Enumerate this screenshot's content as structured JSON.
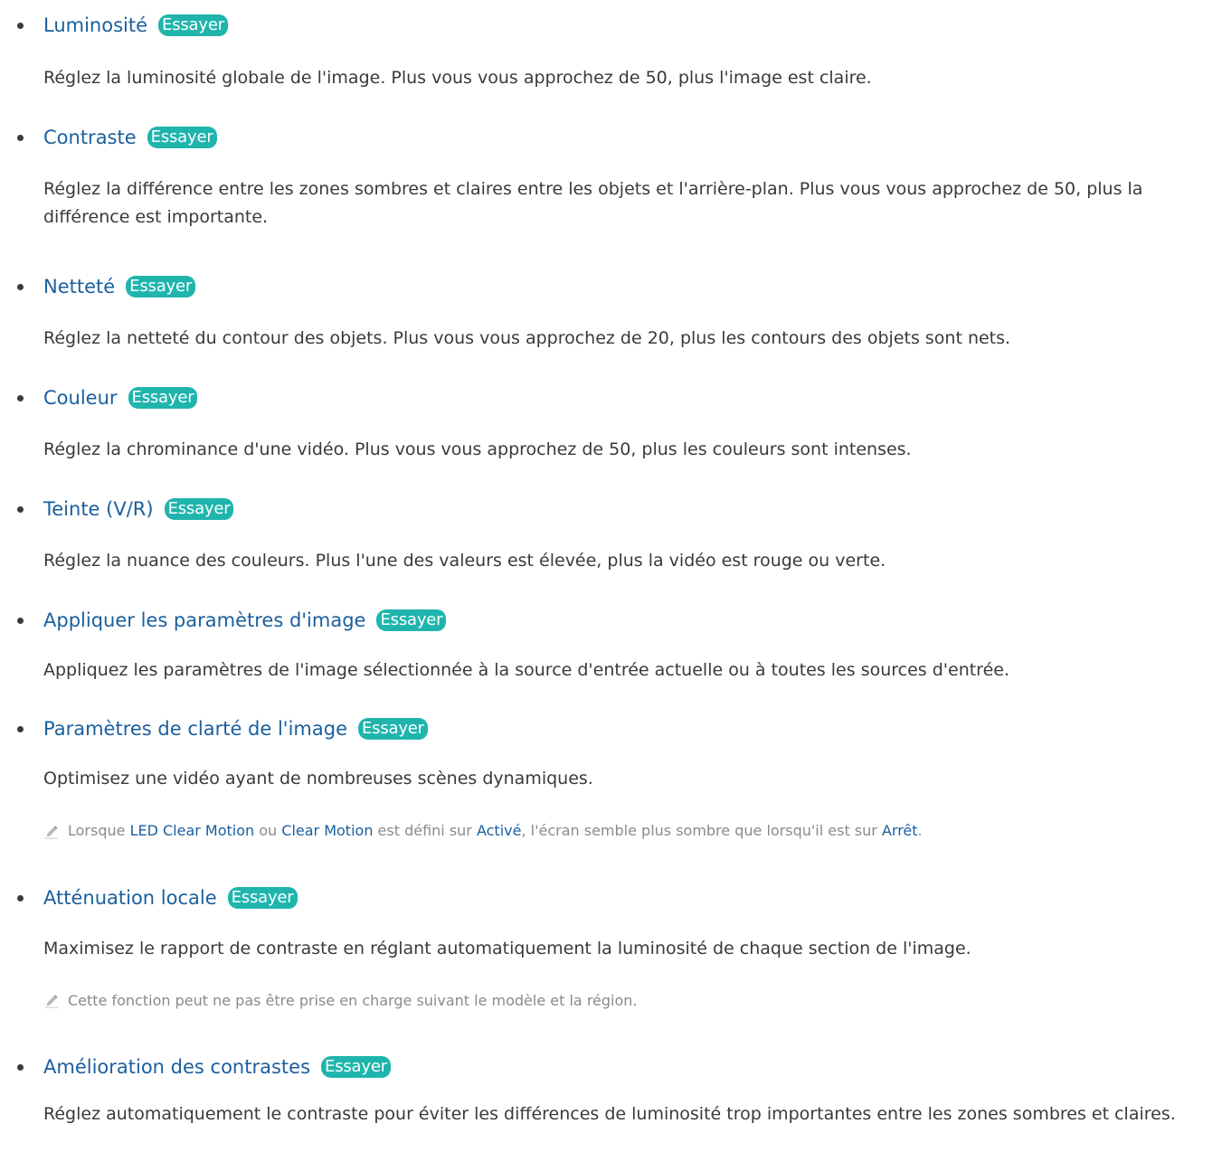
{
  "try_label": "Essayer",
  "items": [
    {
      "title": "Luminosité",
      "description": "Réglez la luminosité globale de l'image. Plus vous vous approchez de 50, plus l'image est claire."
    },
    {
      "title": "Contraste",
      "description": "Réglez la différence entre les zones sombres et claires entre les objets et l'arrière-plan. Plus vous vous approchez de 50, plus la différence est importante."
    },
    {
      "title": "Netteté",
      "description": "Réglez la netteté du contour des objets. Plus vous vous approchez de 20, plus les contours des objets sont nets."
    },
    {
      "title": "Couleur",
      "description": "Réglez la chrominance d'une vidéo. Plus vous vous approchez de 50, plus les couleurs sont intenses."
    },
    {
      "title": "Teinte (V/R)",
      "description": "Réglez la nuance des couleurs. Plus l'une des valeurs est élevée, plus la vidéo est rouge ou verte."
    },
    {
      "title": "Appliquer les paramètres d'image",
      "description": "Appliquez les paramètres de l'image sélectionnée à la source d'entrée actuelle ou à toutes les sources d'entrée."
    },
    {
      "title": "Paramètres de clarté de l'image",
      "description": "Optimisez une vidéo ayant de nombreuses scènes dynamiques.",
      "note": {
        "p1": "Lorsque ",
        "k1": "LED Clear Motion",
        "p2": " ou ",
        "k2": "Clear Motion",
        "p3": " est défini sur ",
        "k3": "Activé",
        "p4": ", l'écran semble plus sombre que lorsqu'il est sur ",
        "k4": "Arrêt",
        "p5": "."
      }
    },
    {
      "title": "Atténuation locale",
      "description": "Maximisez le rapport de contraste en réglant automatiquement la luminosité de chaque section de l'image.",
      "note_text": "Cette fonction peut ne pas être prise en charge suivant le modèle et la région."
    },
    {
      "title": "Amélioration des contrastes",
      "description": "Réglez automatiquement le contraste pour éviter les différences de luminosité trop importantes entre les zones sombres et claires."
    }
  ],
  "colors": {
    "link": "#1a5f9e",
    "try_button": "#1fb5ad",
    "body_text": "#3a3a3a",
    "note_text": "#8a8a8a"
  },
  "icons": {
    "note": "pencil-icon"
  }
}
